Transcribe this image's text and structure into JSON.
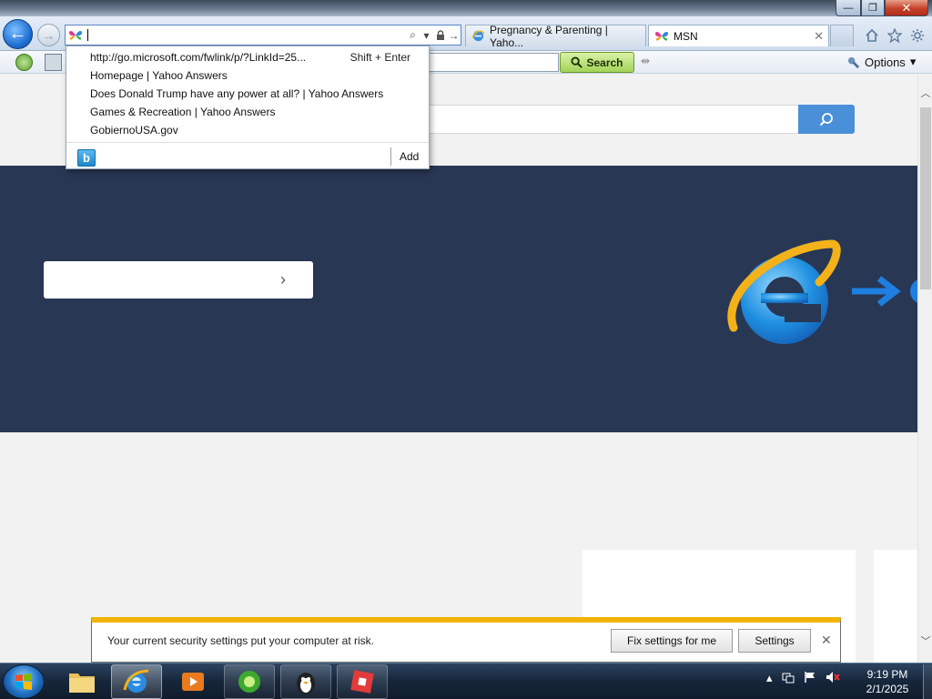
{
  "titlebar": {
    "minimize_label": "—",
    "maximize_label": "❐",
    "close_label": "✕"
  },
  "nav": {
    "back_glyph": "←",
    "forward_glyph": "→",
    "address_value": "",
    "search_glyph": "⌕",
    "dropdown_glyph": "▾",
    "lock_glyph": "🔒",
    "go_glyph": "→"
  },
  "tabs": [
    {
      "label": "Pregnancy & Parenting | Yaho...",
      "icon": "ie-icon",
      "active": false
    },
    {
      "label": "MSN",
      "icon": "msn-butterfly-icon",
      "active": true,
      "close": "✕"
    }
  ],
  "toolbar": {
    "search_label": "Search",
    "options_label": "Options",
    "options_caret": "▾"
  },
  "address_dropdown": {
    "suggestions": [
      {
        "text": "http://go.microsoft.com/fwlink/p/?LinkId=25...",
        "hint": "Shift + Enter"
      },
      {
        "text": "Homepage | Yahoo Answers"
      },
      {
        "text": "Does Donald Trump have any power at all? | Yahoo Answers"
      },
      {
        "text": "Games & Recreation | Yahoo Answers"
      },
      {
        "text": "GobiernoUSA.gov"
      }
    ],
    "add_label": "Add",
    "bing_letter": "b"
  },
  "page": {
    "banner_chevron": "›",
    "colors": {
      "banner": "#283754",
      "search_button": "#4a90d9"
    }
  },
  "notification": {
    "message": "Your current security settings put your computer at risk.",
    "fix_label": "Fix settings for me",
    "settings_label": "Settings",
    "close_label": "✕",
    "accent": "#f0b400"
  },
  "taskbar": {
    "time": "9:19 PM",
    "date": "2/1/2025",
    "apps": [
      "file-explorer-icon",
      "internet-explorer-icon",
      "media-player-icon",
      "green-app-icon",
      "penguin-game-icon",
      "roblox-icon"
    ]
  }
}
